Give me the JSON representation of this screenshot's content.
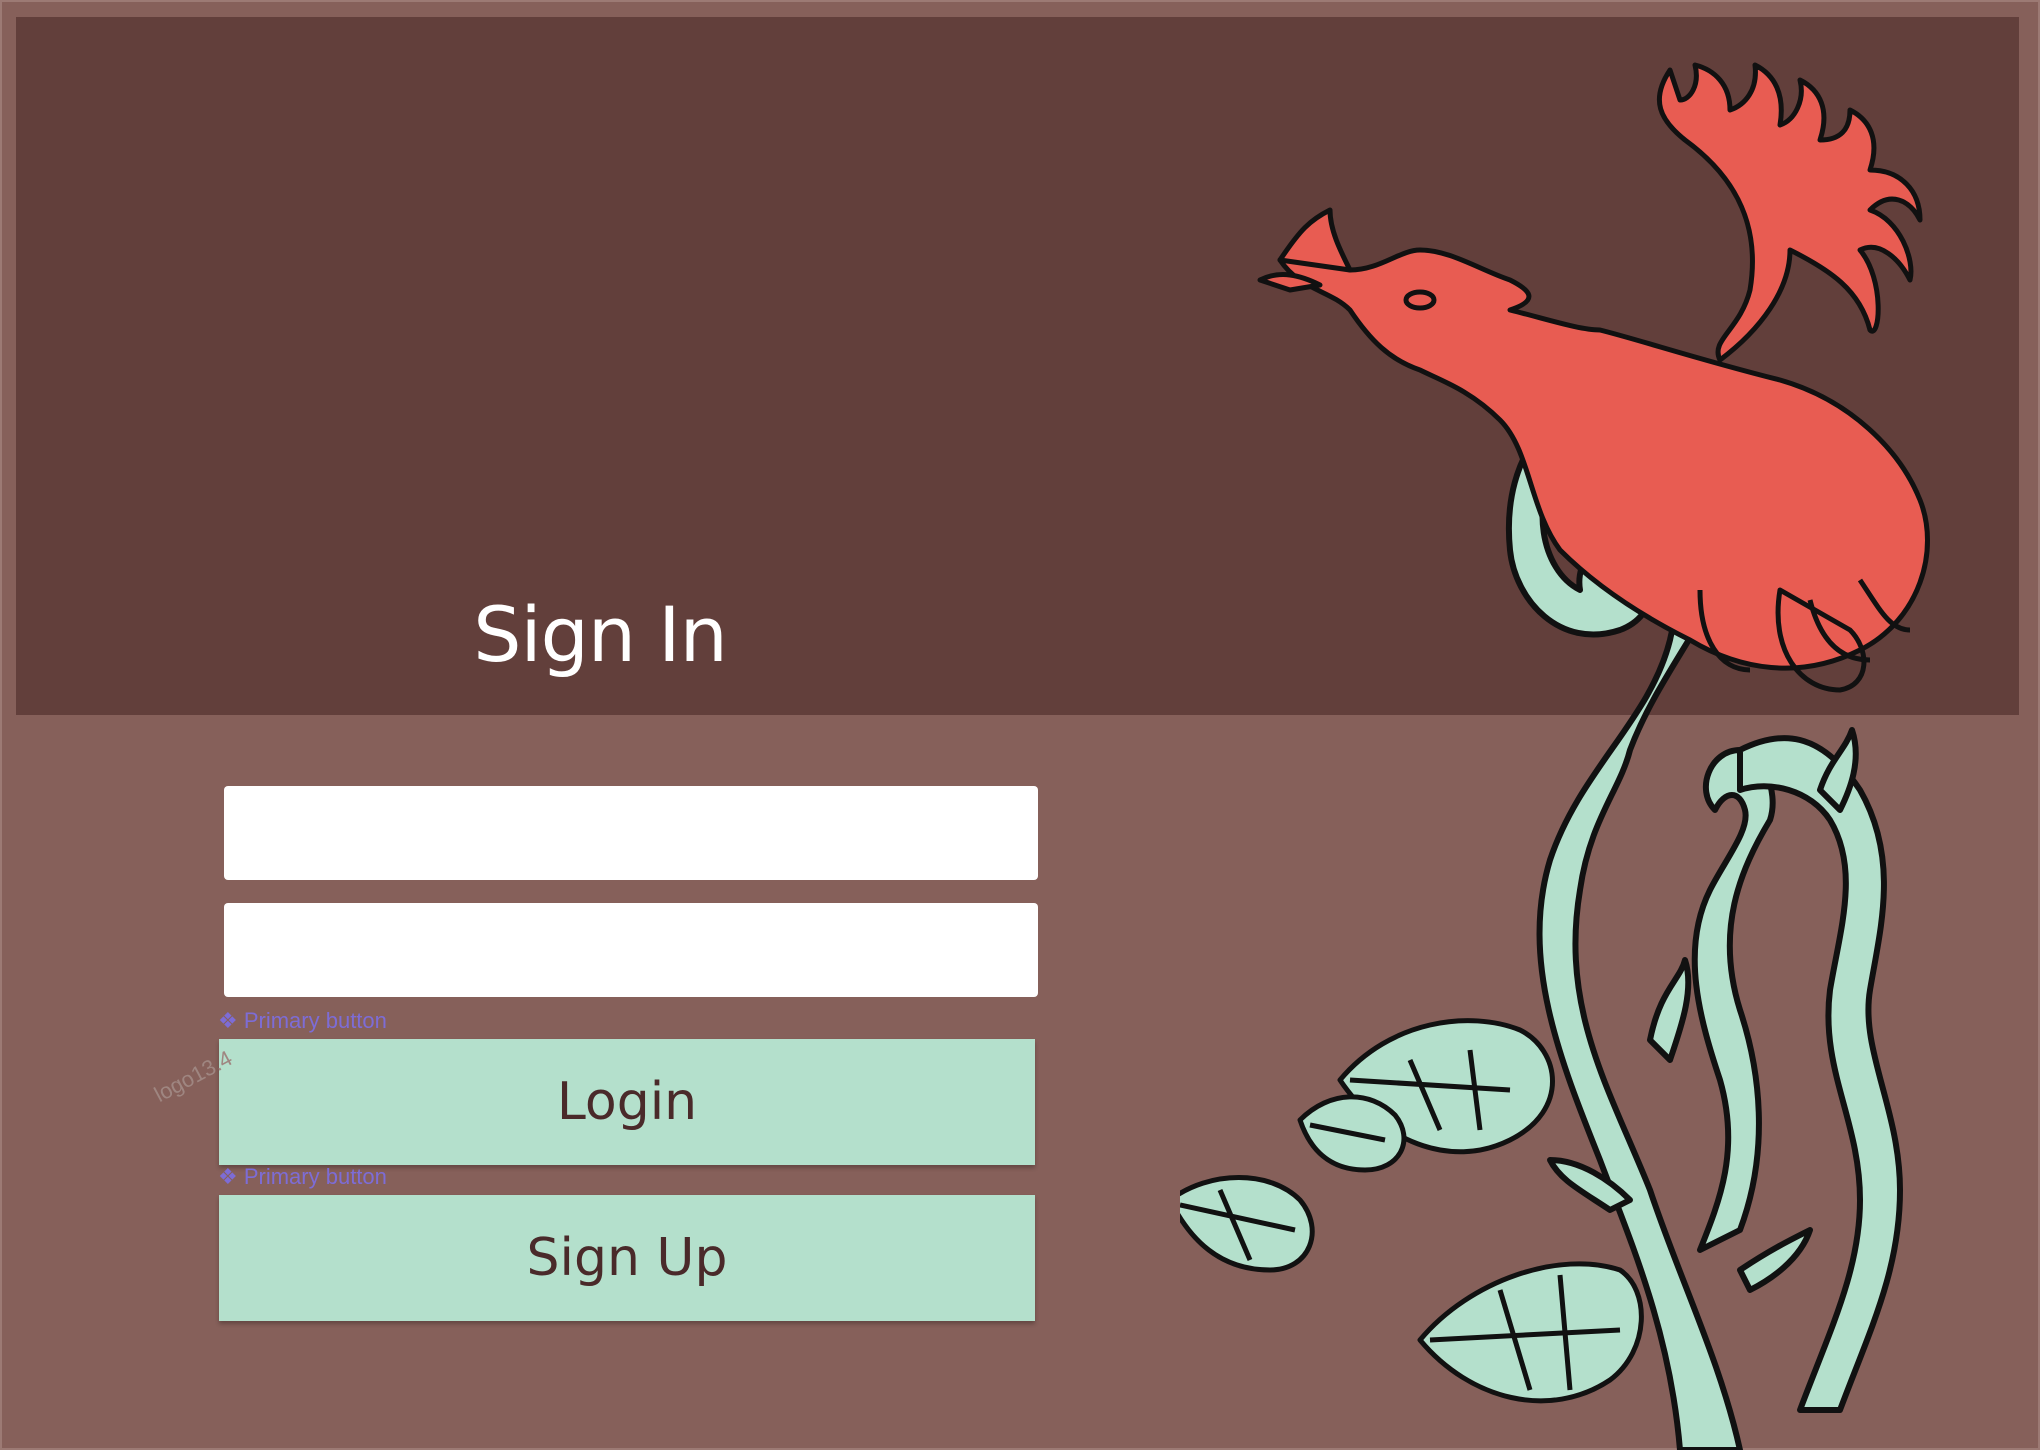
{
  "form": {
    "title": "Sign In",
    "username_field": {
      "value": "",
      "placeholder": ""
    },
    "password_field": {
      "value": "",
      "placeholder": ""
    },
    "login_button_label": "Login",
    "signup_button_label": "Sign Up",
    "component_tag_login": "❖ Primary button",
    "component_tag_signup": "❖ Primary button",
    "logo_ghost_label": "logo13.4"
  },
  "colors": {
    "page_background": "#86605a",
    "header_band": "#623f3b",
    "button_fill": "#b4e0cc",
    "button_text": "#4a2a2a",
    "bird": "#e85c52",
    "vine": "#b4e0cc"
  },
  "decoration": {
    "illustration": "bird-on-vine-illustration"
  }
}
